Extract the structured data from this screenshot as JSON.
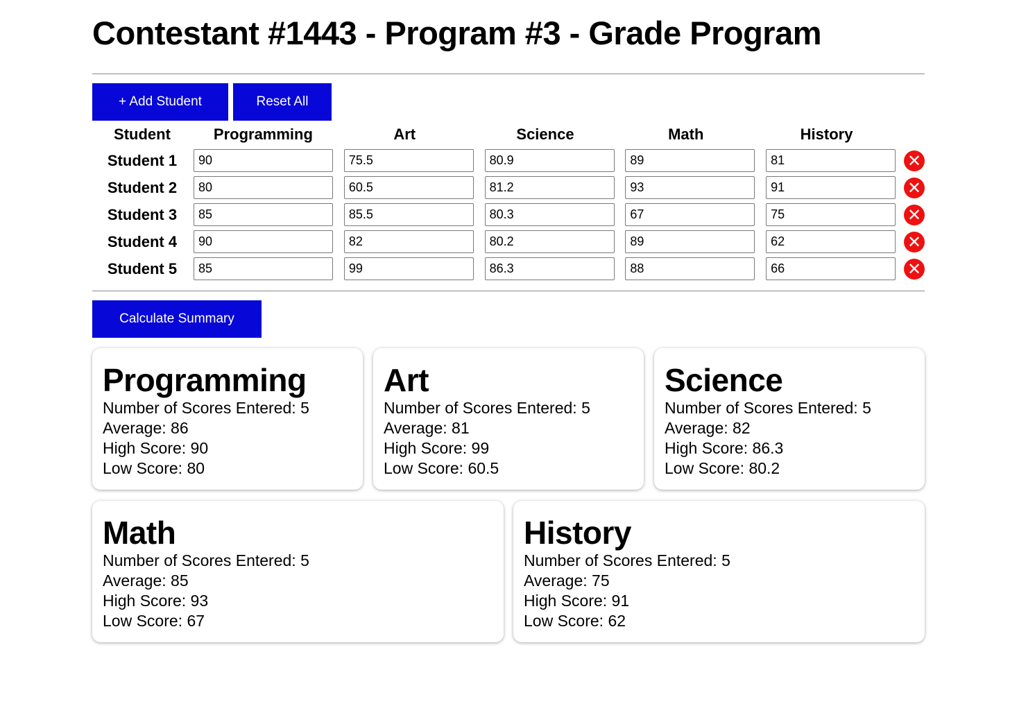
{
  "page": {
    "title": "Contestant #1443 - Program #3 - Grade Program"
  },
  "toolbar": {
    "add_label": "+ Add Student",
    "reset_label": "Reset All",
    "calculate_label": "Calculate Summary"
  },
  "table": {
    "headers": [
      "Student",
      "Programming",
      "Art",
      "Science",
      "Math",
      "History"
    ],
    "rows": [
      {
        "name": "Student 1",
        "scores": [
          "90",
          "75.5",
          "80.9",
          "89",
          "81"
        ]
      },
      {
        "name": "Student 2",
        "scores": [
          "80",
          "60.5",
          "81.2",
          "93",
          "91"
        ]
      },
      {
        "name": "Student 3",
        "scores": [
          "85",
          "85.5",
          "80.3",
          "67",
          "75"
        ]
      },
      {
        "name": "Student 4",
        "scores": [
          "90",
          "82",
          "80.2",
          "89",
          "62"
        ]
      },
      {
        "name": "Student 5",
        "scores": [
          "85",
          "99",
          "86.3",
          "88",
          "66"
        ]
      }
    ],
    "delete_icon": "close-icon",
    "delete_glyph": "✕"
  },
  "summary": [
    {
      "subject": "Programming",
      "count": "Number of Scores Entered: 5",
      "average": "Average: 86",
      "high": "High Score: 90",
      "low": "Low Score: 80"
    },
    {
      "subject": "Art",
      "count": "Number of Scores Entered: 5",
      "average": "Average: 81",
      "high": "High Score: 99",
      "low": "Low Score: 60.5"
    },
    {
      "subject": "Science",
      "count": "Number of Scores Entered: 5",
      "average": "Average: 82",
      "high": "High Score: 86.3",
      "low": "Low Score: 80.2"
    },
    {
      "subject": "Math",
      "count": "Number of Scores Entered: 5",
      "average": "Average: 85",
      "high": "High Score: 93",
      "low": "Low Score: 67"
    },
    {
      "subject": "History",
      "count": "Number of Scores Entered: 5",
      "average": "Average: 75",
      "high": "High Score: 91",
      "low": "Low Score: 62"
    }
  ],
  "colors": {
    "button_bg": "#0707d8",
    "delete_bg": "#ee1111"
  }
}
